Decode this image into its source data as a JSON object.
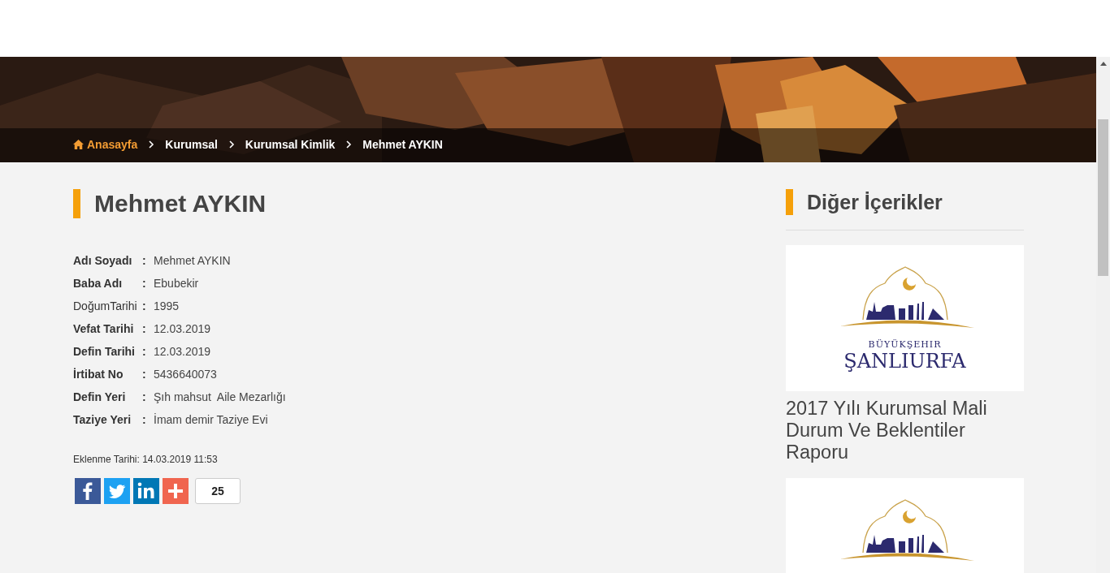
{
  "breadcrumb": [
    {
      "label": "Anasayfa",
      "kind": "home"
    },
    {
      "label": "Kurumsal",
      "kind": "link"
    },
    {
      "label": "Kurumsal Kimlik",
      "kind": "link"
    },
    {
      "label": "Mehmet AYKIN",
      "kind": "current"
    }
  ],
  "title": "Mehmet AYKIN",
  "details": [
    {
      "label": "Adı Soyadı",
      "sep": ":",
      "value": "Mehmet AYKIN",
      "bold": true
    },
    {
      "label": "Baba Adı",
      "sep": ":",
      "value": "Ebubekir",
      "bold": true
    },
    {
      "label": "DoğumTarihi",
      "sep": ":",
      "value": "1995",
      "bold": false
    },
    {
      "label": "Vefat Tarihi",
      "sep": ":",
      "value": "12.03.2019",
      "bold": true
    },
    {
      "label": "Defin Tarihi",
      "sep": ":",
      "value": "12.03.2019",
      "bold": true
    },
    {
      "label": "İrtibat No",
      "sep": ":",
      "value": "5436640073",
      "bold": true
    },
    {
      "label": "Defin Yeri",
      "sep": ":",
      "value": "Şıh mahsut  Aile Mezarlığı",
      "bold": true
    },
    {
      "label": "Taziye Yeri",
      "sep": ":",
      "value": "İmam demir Taziye Evi",
      "bold": true
    }
  ],
  "added": "Eklenme Tarihi: 14.03.2019 11:53",
  "share": {
    "buttons": [
      {
        "kind": "facebook"
      },
      {
        "kind": "twitter"
      },
      {
        "kind": "linkedin"
      },
      {
        "kind": "more"
      }
    ],
    "count": "25"
  },
  "sidebar": {
    "title": "Diğer İçerikler",
    "items": [
      {
        "kind": "logo",
        "logo_top": "BÜYÜKŞEHIR",
        "logo_name": "ŞANLIURFA",
        "title": "2017 Yılı Kurumsal Mali Durum Ve Beklentiler Raporu"
      },
      {
        "kind": "logo"
      }
    ]
  }
}
